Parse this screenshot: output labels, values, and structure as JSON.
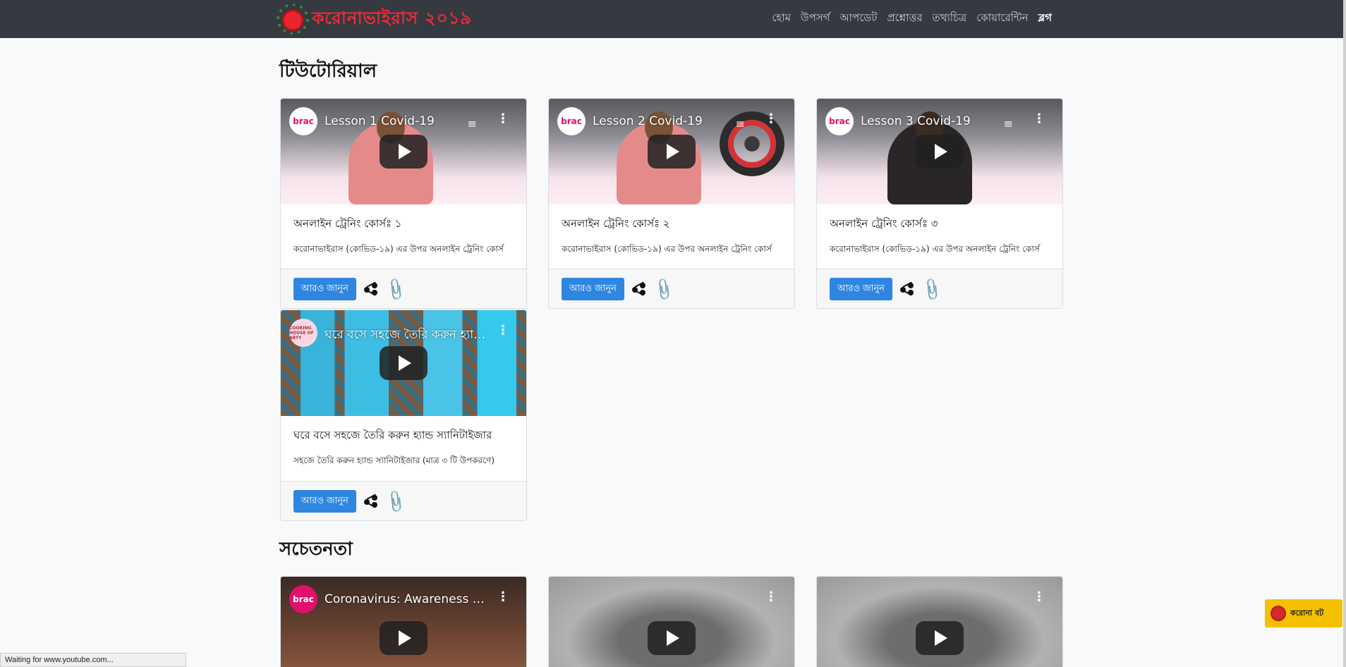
{
  "brand": {
    "title": "করোনাভাইরাস ২০১৯"
  },
  "nav": [
    "হোম",
    "উপসর্গ",
    "আপডেট",
    "প্রশ্নোত্তর",
    "তথ্যচিত্র",
    "কোয়ারেন্টিন",
    "ব্লগ"
  ],
  "sections": {
    "tutorial": "টিউটোরিয়াল",
    "awareness": "সচেতনতা"
  },
  "cards": [
    {
      "video_title": "Lesson 1 Covid-19",
      "channel": "brac",
      "title": "অনলাইন ট্রেনিং কোর্সঃ ১",
      "text": "করোনাভাইরাস (কোভিড-১৯) এর উপর অনলাইন ট্রেনিং কোর্স",
      "button": "আরও জানুন"
    },
    {
      "video_title": "Lesson 2 Covid-19",
      "channel": "brac",
      "title": "অনলাইন ট্রেনিং কোর্সঃ ২",
      "text": "করোনাভাইরাস (কোভিড-১৯) এর উপর অনলাইন ট্রেনিং কোর্স",
      "button": "আরও জানুন"
    },
    {
      "video_title": "Lesson 3 Covid-19",
      "channel": "brac",
      "title": "অনলাইন ট্রেনিং কোর্সঃ ৩",
      "text": "করোনাভাইরাস (কোভিড-১৯) এর উপর অনলাইন ট্রেনিং কোর্স",
      "button": "আরও জানুন"
    },
    {
      "video_title": "ঘরে বসে সহজে তৈরি করুন হ্যান্ড ...",
      "channel": "COOKING HOUSE OF ARTY",
      "title": "ঘরে বসে সহজে তৈরি করুন হ্যান্ড স্যানিটাইজার",
      "text": "সহজে তৈরি করুন হ্যান্ড স্যানিটাইজার (মাত্র ৩ টি উপকরণে)",
      "button": "আরও জানুন"
    }
  ],
  "awareness_videos": [
    {
      "video_title": "Coronavirus: Awareness | ...",
      "channel": "brac"
    },
    {
      "video_title": ""
    },
    {
      "video_title": ""
    }
  ],
  "chatbot": {
    "label": "করোনা বট"
  },
  "status_bar": "Waiting for www.youtube.com...",
  "colors": {
    "navbar": "#343a40",
    "brand": "#ea2b36",
    "button": "#2f86e0",
    "chatbot": "#f5c000"
  }
}
